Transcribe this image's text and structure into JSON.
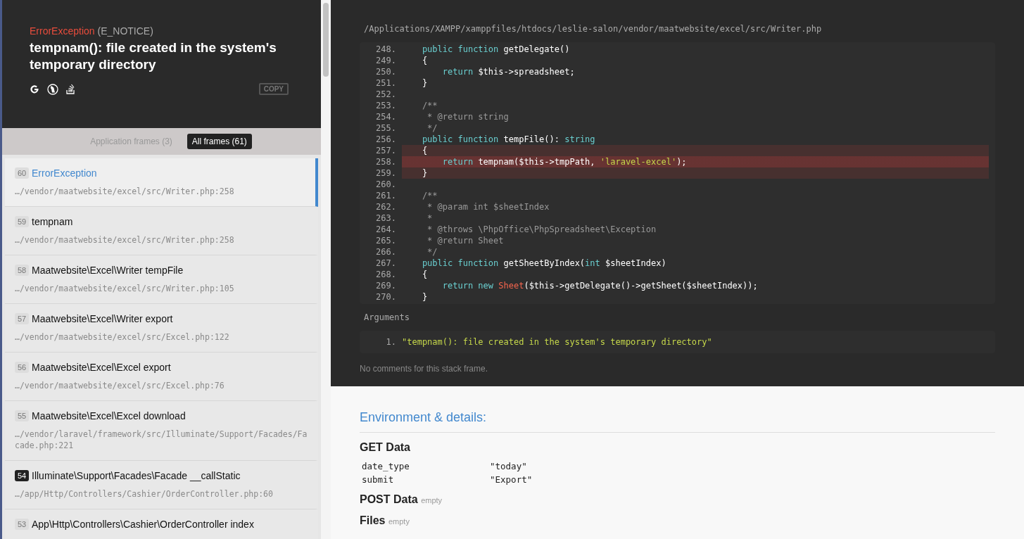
{
  "header": {
    "exception_class": "ErrorException",
    "error_code": "(E_NOTICE)",
    "message": "tempnam(): file created in the system's temporary directory",
    "copy_button": "COPY"
  },
  "frame_tabs": [
    {
      "label": "Application frames (3)",
      "selected": false
    },
    {
      "label": "All frames (61)",
      "selected": true
    }
  ],
  "frames": [
    {
      "index": "60",
      "title": "ErrorException",
      "path": "…/vendor/maatwebsite/excel/src/Writer.php:258",
      "selected": true,
      "application": false
    },
    {
      "index": "59",
      "title": "tempnam",
      "path": "…/vendor/maatwebsite/excel/src/Writer.php:258",
      "selected": false,
      "application": false
    },
    {
      "index": "58",
      "title": "Maatwebsite\\Excel\\Writer tempFile",
      "path": "…/vendor/maatwebsite/excel/src/Writer.php:105",
      "selected": false,
      "application": false
    },
    {
      "index": "57",
      "title": "Maatwebsite\\Excel\\Writer export",
      "path": "…/vendor/maatwebsite/excel/src/Excel.php:122",
      "selected": false,
      "application": false
    },
    {
      "index": "56",
      "title": "Maatwebsite\\Excel\\Excel export",
      "path": "…/vendor/maatwebsite/excel/src/Excel.php:76",
      "selected": false,
      "application": false
    },
    {
      "index": "55",
      "title": "Maatwebsite\\Excel\\Excel download",
      "path": "…/vendor/laravel/framework/src/Illuminate/Support/Facades/Facade.php:221",
      "selected": false,
      "application": false
    },
    {
      "index": "54",
      "title": "Illuminate\\Support\\Facades\\Facade __callStatic",
      "path": "…/app/Http/Controllers/Cashier/OrderController.php:60",
      "selected": false,
      "application": true
    },
    {
      "index": "53",
      "title": "App\\Http\\Controllers\\Cashier\\OrderController index",
      "selected": false,
      "application": false
    }
  ],
  "file_path": "/Applications/XAMPP/xamppfiles/htdocs/leslie-salon/vendor/maatwebsite/excel/src/Writer.php",
  "code_lines": [
    {
      "number": "248.",
      "highlighted": false,
      "error": false,
      "tokens": [
        {
          "kind": "keyword",
          "text": "    public function "
        },
        {
          "kind": "plain",
          "text": "getDelegate()"
        }
      ]
    },
    {
      "number": "249.",
      "highlighted": false,
      "error": false,
      "tokens": [
        {
          "kind": "plain",
          "text": "    {"
        }
      ]
    },
    {
      "number": "250.",
      "highlighted": false,
      "error": false,
      "tokens": [
        {
          "kind": "keyword",
          "text": "        return "
        },
        {
          "kind": "plain",
          "text": "$this->spreadsheet;"
        }
      ]
    },
    {
      "number": "251.",
      "highlighted": false,
      "error": false,
      "tokens": [
        {
          "kind": "plain",
          "text": "    }"
        }
      ]
    },
    {
      "number": "252.",
      "highlighted": false,
      "error": false
    },
    {
      "number": "253.",
      "highlighted": false,
      "error": false,
      "tokens": [
        {
          "kind": "comment",
          "text": "    /**"
        }
      ]
    },
    {
      "number": "254.",
      "highlighted": false,
      "error": false,
      "tokens": [
        {
          "kind": "comment",
          "text": "     * @return string"
        }
      ]
    },
    {
      "number": "255.",
      "highlighted": false,
      "error": false,
      "tokens": [
        {
          "kind": "comment",
          "text": "     */"
        }
      ]
    },
    {
      "number": "256.",
      "highlighted": false,
      "error": false,
      "tokens": [
        {
          "kind": "keyword",
          "text": "    public function "
        },
        {
          "kind": "plain",
          "text": "tempFile(): "
        },
        {
          "kind": "keyword",
          "text": "string"
        }
      ]
    },
    {
      "number": "257.",
      "highlighted": true,
      "error": false,
      "tokens": [
        {
          "kind": "plain",
          "text": "    {"
        }
      ]
    },
    {
      "number": "258.",
      "highlighted": true,
      "error": true,
      "tokens": [
        {
          "kind": "keyword",
          "text": "        return "
        },
        {
          "kind": "plain",
          "text": "tempnam($this->tmpPath, "
        },
        {
          "kind": "string",
          "text": "'laravel-excel'"
        },
        {
          "kind": "plain",
          "text": ");"
        }
      ]
    },
    {
      "number": "259.",
      "highlighted": true,
      "error": false,
      "tokens": [
        {
          "kind": "plain",
          "text": "    }"
        }
      ]
    },
    {
      "number": "260.",
      "highlighted": false,
      "error": false
    },
    {
      "number": "261.",
      "highlighted": false,
      "error": false,
      "tokens": [
        {
          "kind": "comment",
          "text": "    /**"
        }
      ]
    },
    {
      "number": "262.",
      "highlighted": false,
      "error": false,
      "tokens": [
        {
          "kind": "comment",
          "text": "     * @param int $sheetIndex"
        }
      ]
    },
    {
      "number": "263.",
      "highlighted": false,
      "error": false,
      "tokens": [
        {
          "kind": "comment",
          "text": "     *"
        }
      ]
    },
    {
      "number": "264.",
      "highlighted": false,
      "error": false,
      "tokens": [
        {
          "kind": "comment",
          "text": "     * @throws \\PhpOffice\\PhpSpreadsheet\\Exception"
        }
      ]
    },
    {
      "number": "265.",
      "highlighted": false,
      "error": false,
      "tokens": [
        {
          "kind": "comment",
          "text": "     * @return Sheet"
        }
      ]
    },
    {
      "number": "266.",
      "highlighted": false,
      "error": false,
      "tokens": [
        {
          "kind": "comment",
          "text": "     */"
        }
      ]
    },
    {
      "number": "267.",
      "highlighted": false,
      "error": false,
      "tokens": [
        {
          "kind": "keyword",
          "text": "    public function "
        },
        {
          "kind": "plain",
          "text": "getSheetByIndex("
        },
        {
          "kind": "keyword",
          "text": "int "
        },
        {
          "kind": "plain",
          "text": "$sheetIndex)"
        }
      ]
    },
    {
      "number": "268.",
      "highlighted": false,
      "error": false,
      "tokens": [
        {
          "kind": "plain",
          "text": "    {"
        }
      ]
    },
    {
      "number": "269.",
      "highlighted": false,
      "error": false,
      "tokens": [
        {
          "kind": "keyword",
          "text": "        return new "
        },
        {
          "kind": "class",
          "text": "Sheet"
        },
        {
          "kind": "plain",
          "text": "($this->getDelegate()->getSheet($sheetIndex));"
        }
      ]
    },
    {
      "number": "270.",
      "highlighted": false,
      "error": false,
      "tokens": [
        {
          "kind": "plain",
          "text": "    }"
        }
      ]
    }
  ],
  "arguments": {
    "heading": "Arguments",
    "items": [
      {
        "number": "1.",
        "value": "\"tempnam(): file created in the system's temporary directory\""
      }
    ]
  },
  "comments_note": "No comments for this stack frame.",
  "environment": {
    "heading": "Environment & details:",
    "sections": [
      {
        "title": "GET Data",
        "rows": [
          {
            "key": "date_type",
            "value": "\"today\""
          },
          {
            "key": "submit",
            "value": "\"Export\""
          }
        ]
      },
      {
        "title": "POST Data",
        "empty_label": "empty"
      },
      {
        "title": "Files",
        "empty_label": "empty"
      }
    ]
  }
}
